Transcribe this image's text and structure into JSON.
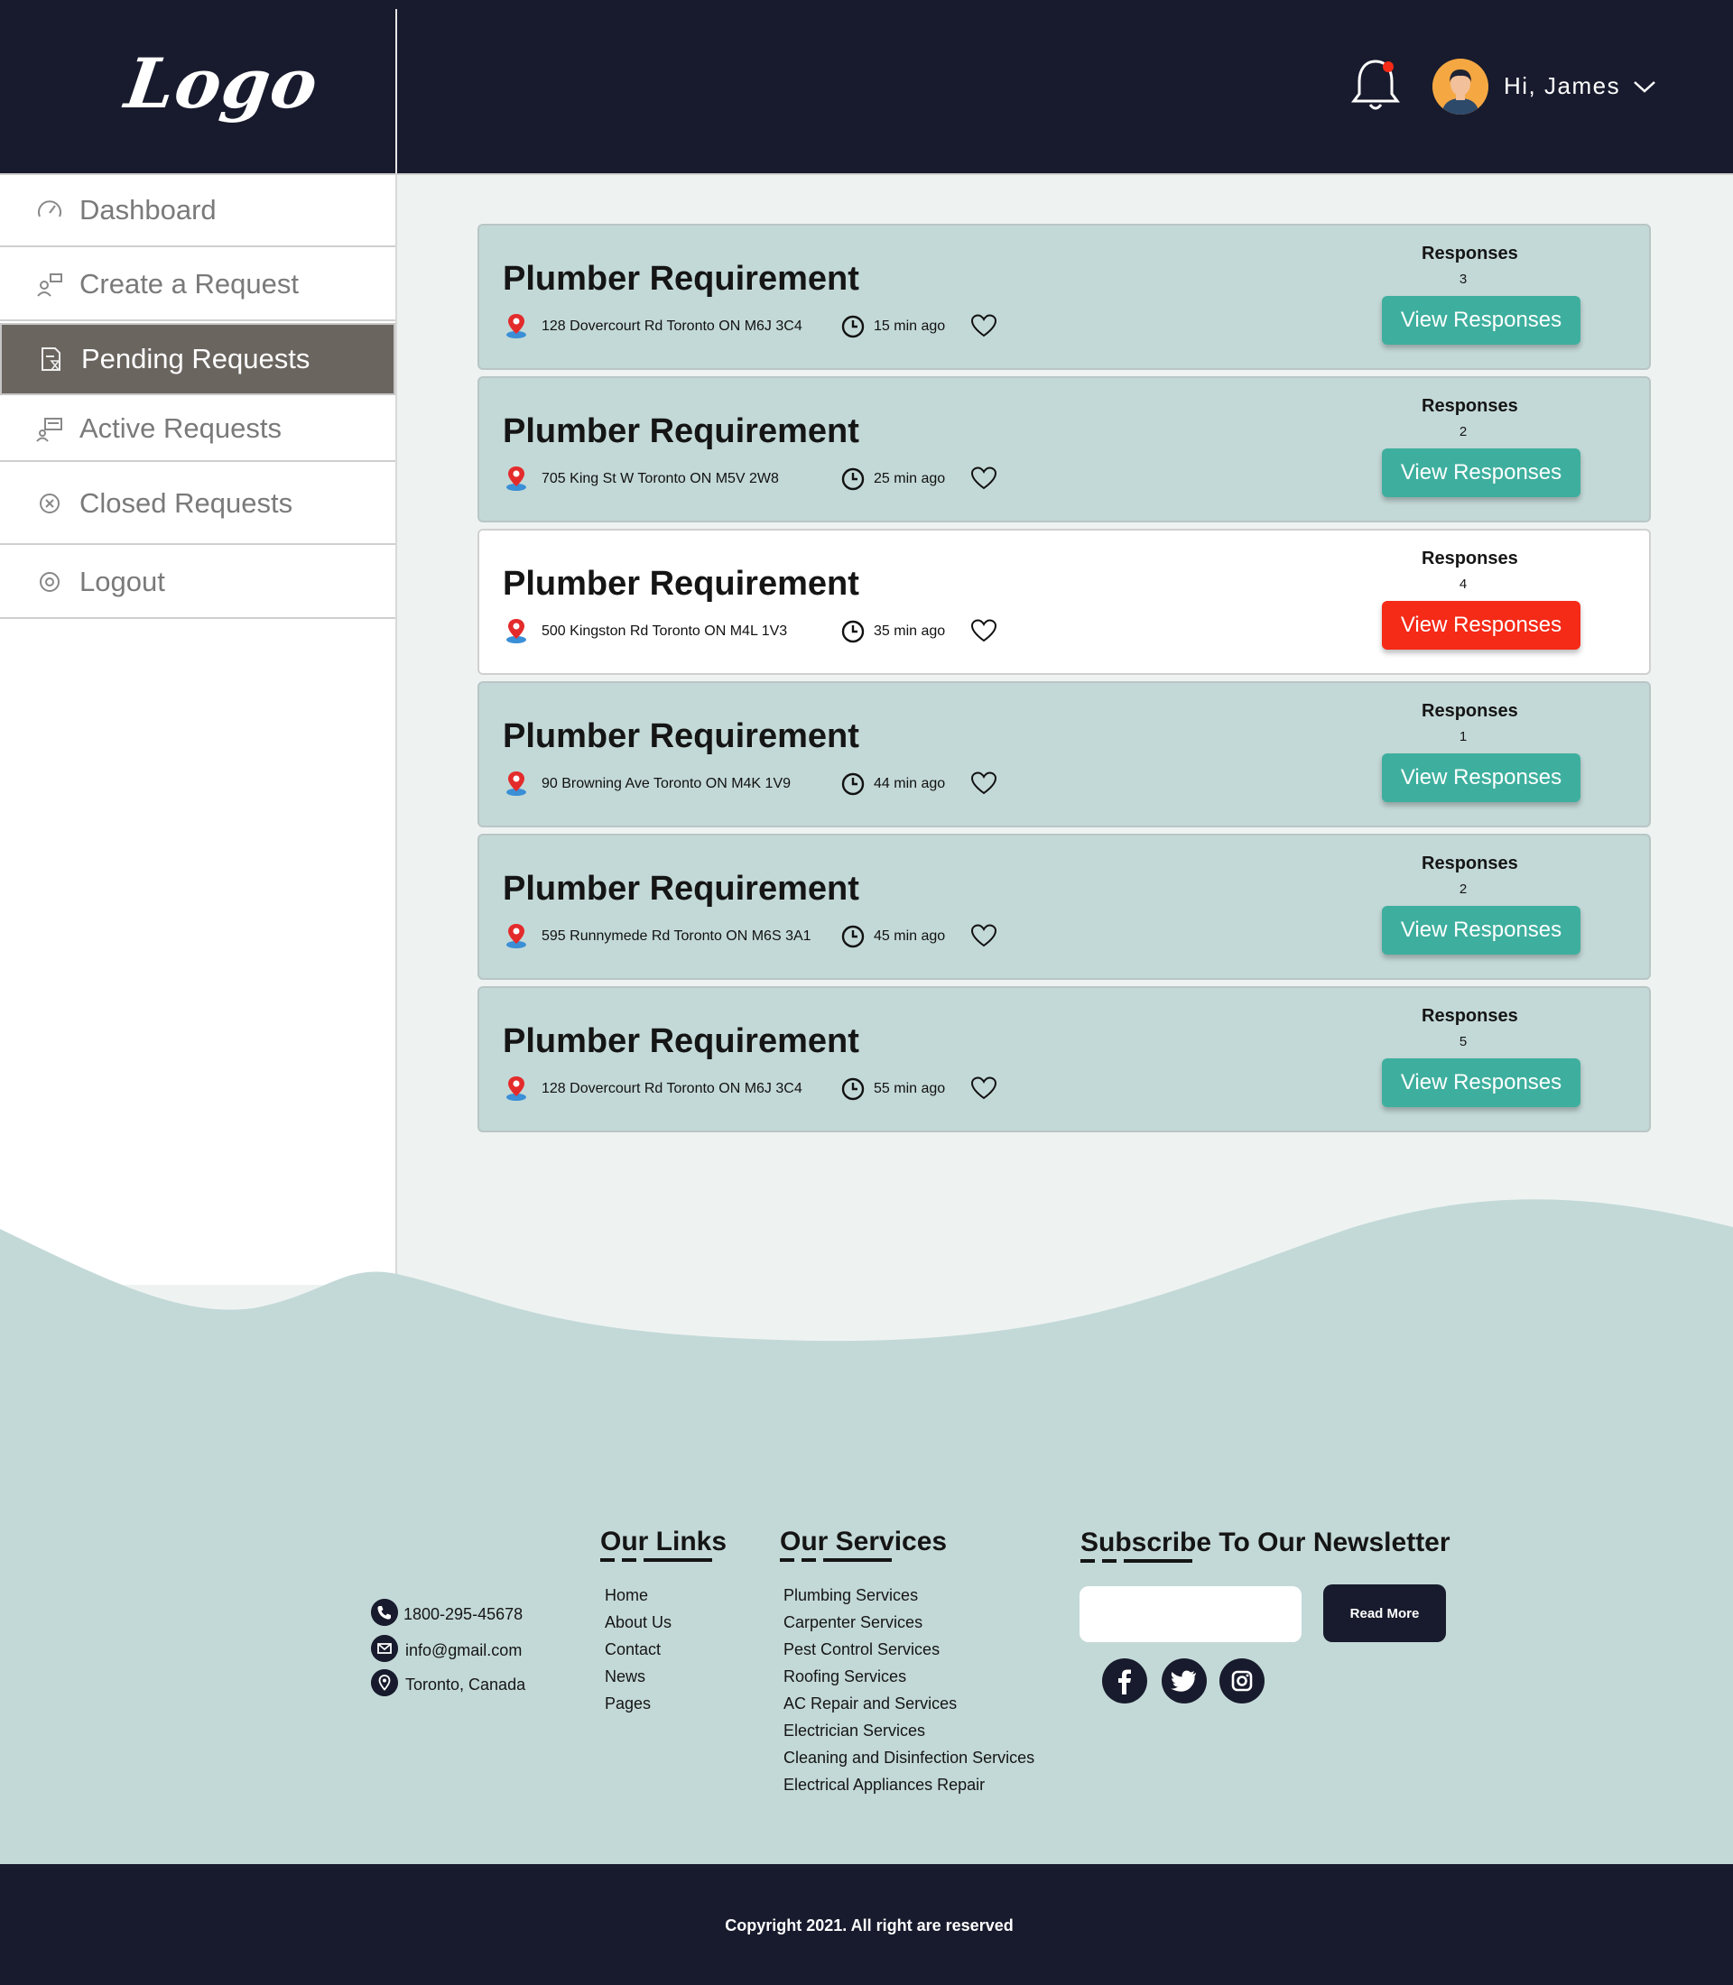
{
  "header": {
    "logo": "Logo",
    "greeting": "Hi, James"
  },
  "sidebar": {
    "items": [
      {
        "label": "Dashboard",
        "icon": "speedometer-icon"
      },
      {
        "label": "Create a Request",
        "icon": "create-request-icon"
      },
      {
        "label": "Pending Requests",
        "icon": "pending-document-icon",
        "active": true
      },
      {
        "label": "Active Requests",
        "icon": "active-requests-icon"
      },
      {
        "label": "Closed Requests",
        "icon": "close-circle-icon"
      },
      {
        "label": "Logout",
        "icon": "logout-icon"
      }
    ]
  },
  "requests": [
    {
      "title": "Plumber Requirement",
      "address": "128 Dovercourt Rd Toronto ON M6J 3C4",
      "time": "15 min ago",
      "responses_label": "Responses",
      "responses": "3",
      "button": "View Responses"
    },
    {
      "title": "Plumber Requirement",
      "address": "705 King St W Toronto ON M5V 2W8",
      "time": "25 min ago",
      "responses_label": "Responses",
      "responses": "2",
      "button": "View Responses"
    },
    {
      "title": "Plumber Requirement",
      "address": "500 Kingston Rd Toronto ON M4L 1V3",
      "time": "35 min ago",
      "responses_label": "Responses",
      "responses": "4",
      "button": "View Responses",
      "highlighted": true
    },
    {
      "title": "Plumber Requirement",
      "address": "90 Browning Ave Toronto ON M4K 1V9",
      "time": "44 min ago",
      "responses_label": "Responses",
      "responses": "1",
      "button": "View Responses"
    },
    {
      "title": "Plumber Requirement",
      "address": "595 Runnymede Rd Toronto ON M6S 3A1",
      "time": "45 min ago",
      "responses_label": "Responses",
      "responses": "2",
      "button": "View Responses"
    },
    {
      "title": "Plumber Requirement",
      "address": "128 Dovercourt Rd Toronto ON M6J 3C4",
      "time": "55 min ago",
      "responses_label": "Responses",
      "responses": "5",
      "button": "View Responses"
    }
  ],
  "footer": {
    "contact": {
      "phone": "1800-295-45678",
      "email": "info@gmail.com",
      "location": "Toronto, Canada"
    },
    "links_heading": "Our Links",
    "links": [
      "Home",
      "About Us",
      "Contact",
      "News",
      "Pages"
    ],
    "services_heading": "Our Services",
    "services": [
      "Plumbing Services",
      "Carpenter Services",
      "Pest Control Services",
      "Roofing Services",
      "AC Repair and Services",
      "Electrician Services",
      "Cleaning and Disinfection Services",
      "Electrical Appliances Repair"
    ],
    "newsletter_heading": "Subscribe To Our Newsletter",
    "newsletter_button": "Read More",
    "copyright": "Copyright 2021. All right are reserved"
  },
  "colors": {
    "header_bg": "#181b2d",
    "card_bg": "#c3d9d7",
    "button_teal": "#3eaf9e",
    "button_red": "#f52a17",
    "sidebar_active": "#6b6560"
  }
}
